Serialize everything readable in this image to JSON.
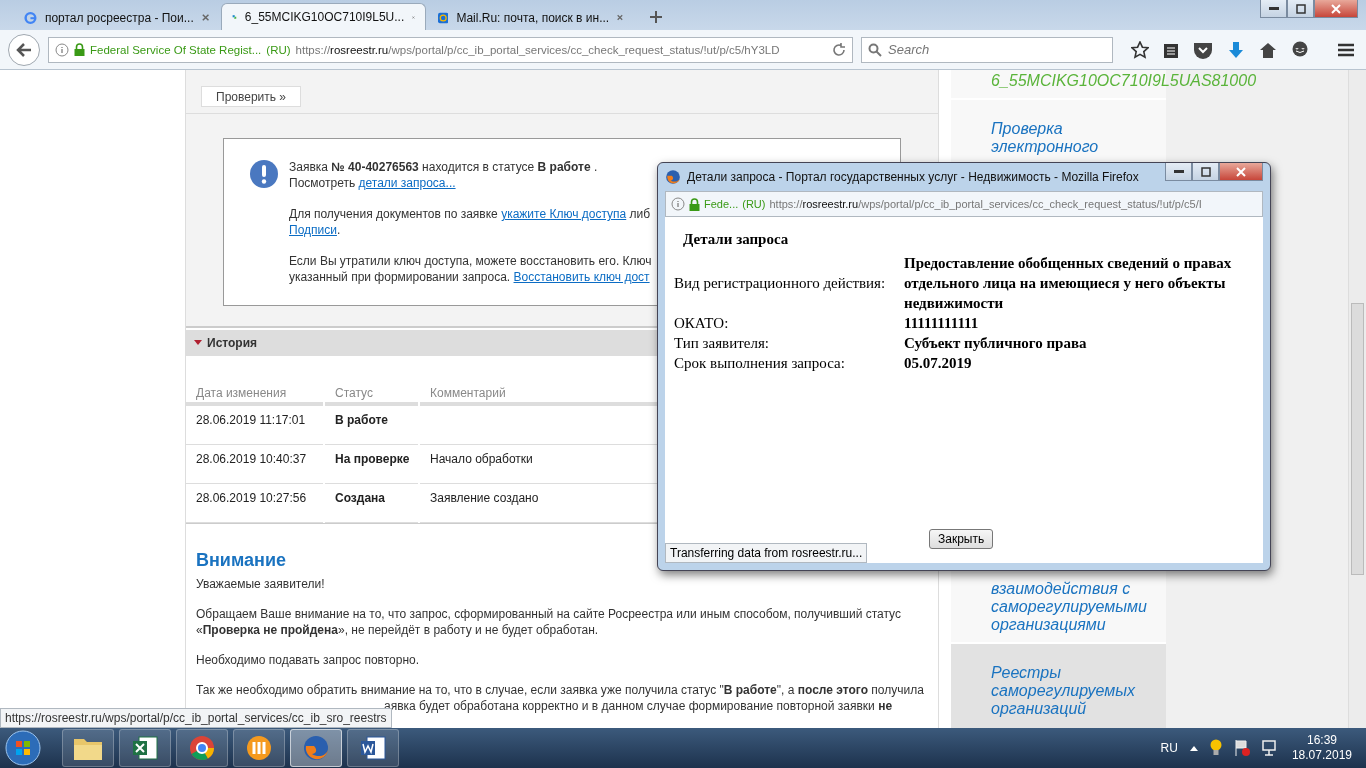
{
  "browser": {
    "tabs": [
      {
        "kind": "search",
        "title": "портал росреестра - Пои...",
        "selected": false
      },
      {
        "kind": "portal",
        "title": "6_55MCIKG10OC710I9L5U...",
        "selected": true
      },
      {
        "kind": "mail",
        "title": "Mail.Ru: почта, поиск в ин...",
        "selected": false
      }
    ],
    "identity": "Federal Service Of State Regist...",
    "country": "(RU)",
    "url_scheme": "https://",
    "url_host": "rosreestr.ru",
    "url_path": "/wps/portal/p/cc_ib_portal_services/cc_check_request_status/!ut/p/c5/hY3LD",
    "search_placeholder": "Search"
  },
  "page": {
    "check_button": "Проверить »",
    "notice": {
      "paragraphs": [
        [
          [
            {
              "kind": "text",
              "text": "Заявка **№ 40-40276563** находится в статусе **В работе** ."
            }
          ],
          [
            {
              "kind": "text",
              "text": "Посмотреть "
            },
            {
              "kind": "link",
              "text": "детали запроса..."
            }
          ]
        ],
        [
          [
            {
              "kind": "text",
              "text": "Для получения документов по заявке "
            },
            {
              "kind": "link",
              "text": "укажите Ключ доступа"
            },
            {
              "kind": "text",
              "text": " либ"
            }
          ],
          [
            {
              "kind": "link",
              "text": "Подписи"
            },
            {
              "kind": "text",
              "text": "."
            }
          ]
        ],
        [
          [
            {
              "kind": "text",
              "text": "Если Вы утратили ключ доступа, можете восстановить его. Ключ"
            }
          ],
          [
            {
              "kind": "text",
              "text": "указанный при формировании запроса. "
            },
            {
              "kind": "link",
              "text": "Восстановить ключ дост"
            }
          ]
        ]
      ]
    },
    "history": {
      "title": "История",
      "expanded": true,
      "columns": [
        "Дата изменения",
        "Статус",
        "Комментарий"
      ],
      "rows": [
        {
          "date": "28.06.2019 11:17:01",
          "status": "В работе"
        },
        {
          "date": "28.06.2019 10:40:37",
          "status": "На проверке",
          "comment": "Начало обработки"
        },
        {
          "date": "28.06.2019 10:27:56",
          "status": "Создана",
          "comment": "Заявление создано"
        }
      ]
    },
    "attention": {
      "title": "Внимание",
      "paragraphs": [
        "Уважаемые заявители!",
        "Обращаем Ваше внимание на то, что запрос, сформированный на сайте Росреестра или иным способом, получивший статус «**Проверка не пройдена**», не перейдёт в работу и не будет обработан.",
        "Необходимо подавать запрос повторно.",
        "Так же необходимо обратить внимание на то, что в случае, если заявка уже получила статус \"**В работе**\", а **после этого** получила"
      ],
      "covered_line": "аявка будет обработана корректно и в данном случае формирование повторной заявки **не**"
    },
    "status_url": "https://rosreestr.ru/wps/portal/p/cc_ib_portal_services/cc_ib_sro_reestrs"
  },
  "sidebar": {
    "items": [
      {
        "kind": "current",
        "text": "6_55MCIKG10OC710I9L5UAS81000",
        "highlighted": false
      },
      {
        "kind": "link",
        "text": "Проверка электронного",
        "highlighted": false
      },
      {
        "kind": "link",
        "text": "взаимодействия с саморегулируемыми организациями",
        "highlighted": false
      },
      {
        "kind": "link",
        "text": "Реестры саморегулируемых организаций",
        "highlighted": true
      }
    ]
  },
  "popup": {
    "title": "Детали запроса - Портал государственных услуг - Недвижимость - Mozilla Firefox",
    "identity": "Fede...",
    "country": "(RU)",
    "url_scheme": "https://",
    "url_host": "rosreestr.ru",
    "url_path": "/wps/portal/p/cc_ib_portal_services/cc_check_request_status/!ut/p/c5/I",
    "heading": "Детали запроса",
    "fields": [
      {
        "label": "Вид регистрационного действия:",
        "value": "Предоставление обобщенных сведений о правах отдельного лица на имеющиеся у него объекты недвижимости"
      },
      {
        "label": "ОКАТО:",
        "value": "11111111111"
      },
      {
        "label": "Тип заявителя:",
        "value": "Субъект публичного права"
      },
      {
        "label": "Срок выполнения запроса:",
        "value": "05.07.2019"
      }
    ],
    "close_button": "Закрыть",
    "status": "Transferring data from rosreestr.ru..."
  },
  "taskbar": {
    "apps": [
      {
        "kind": "folder",
        "active": false
      },
      {
        "kind": "sheet",
        "active": false
      },
      {
        "kind": "chrome",
        "active": false
      },
      {
        "kind": "orange",
        "active": false
      },
      {
        "kind": "firefox",
        "active": true
      },
      {
        "kind": "word",
        "active": false
      }
    ],
    "language": "RU",
    "time": "16:39",
    "date": "18.07.2019"
  }
}
